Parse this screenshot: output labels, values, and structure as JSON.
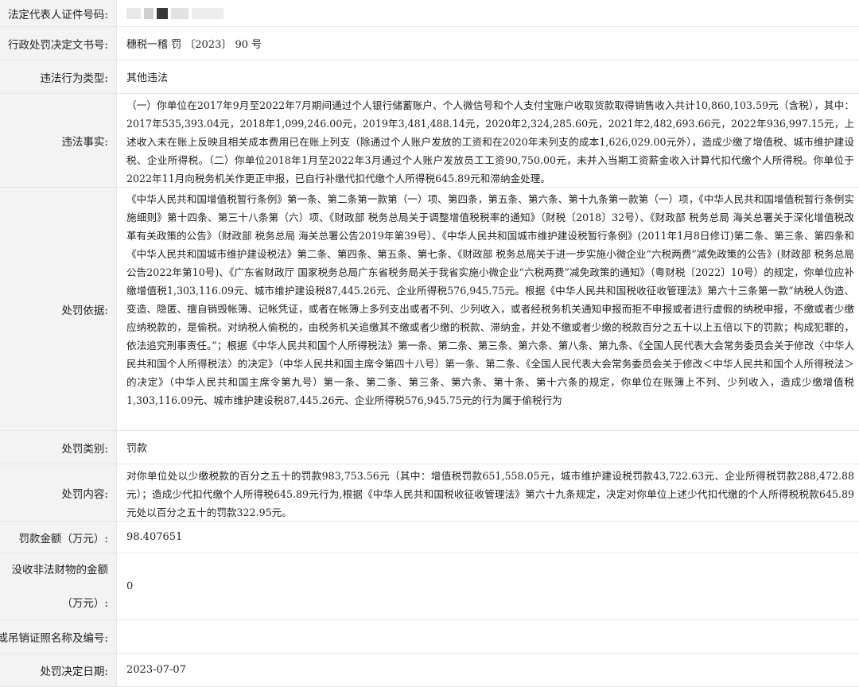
{
  "rows": {
    "id_number": {
      "label": "法定代表人证件号码:",
      "value": ""
    },
    "doc_number": {
      "label": "行政处罚决定文书号:",
      "value": "穗税一稽 罚 〔2023〕 90 号"
    },
    "violation_type": {
      "label": "违法行为类型:",
      "value": "其他违法"
    },
    "facts": {
      "label": "违法事实:",
      "value": "（一）你单位在2017年9月至2022年7月期间通过个人银行储蓄账户、个人微信号和个人支付宝账户收取货款取得销售收入共计10,860,103.59元（含税），其中：2017年535,393.04元，2018年1,099,246.00元，2019年3,481,488.14元，2020年2,324,285.60元，2021年2,482,693.66元，2022年936,997.15元，上述收入未在账上反映且相关成本费用已在账上列支（除通过个人账户发放的工资和在2020年未列支的成本1,626,029.00元外），造成少缴了增值税、城市维护建设税、企业所得税。（二）你单位2018年1月至2022年3月通过个人账户发放员工工资90,750.00元，未并入当期工资薪金收入计算代扣代缴个人所得税。你单位于2022年11月向税务机关作更正申报，已自行补缴代扣代缴个人所得税645.89元和滞纳金处理。"
    },
    "basis": {
      "label": "处罚依据:",
      "value": "《中华人民共和国增值税暂行条例》第一条、第二条第一款第（一）项、第四条，第五条、第六条、第十九条第一款第（一）项，《中华人民共和国增值税暂行条例实施细则》第十四条、第三十八条第（六）项、《财政部 税务总局关于调整增值税税率的通知》（财税〔2018〕32号）、《财政部 税务总局 海关总署关于深化增值税改革有关政策的公告》（财政部 税务总局 海关总署公告2019年第39号）、《中华人民共和国城市维护建设税暂行条例》(2011年1月8日修订)第二条、第三条、第四条和《中华人民共和国城市维护建设税法》第二条、第四条、第五条、第七条、《财政部 税务总局关于进一步实施小微企业“六税两费”减免政策的公告》(财政部 税务总局公告2022年第10号)、《广东省财政厅 国家税务总局广东省税务局关于我省实施小微企业“六税两费”减免政策的通知》（粤财税〔2022〕10号）的规定，你单位应补缴增值税1,303,116.09元、城市维护建设税87,445.26元、企业所得税576,945.75元。根据《中华人民共和国税收征收管理法》第六十三条第一款“纳税人伪造、变造、隐匿、擅自销毁帐簿、记帐凭证，或者在帐簿上多列支出或者不列、少列收入，或者经税务机关通知申报而拒不申报或者进行虚假的纳税申报，不缴或者少缴应纳税款的，是偷税。对纳税人偷税的，由税务机关追缴其不缴或者少缴的税款、滞纳金，并处不缴或者少缴的税款百分之五十以上五倍以下的罚款；构成犯罪的，依法追究刑事责任。”；根据《中华人民共和国个人所得税法》第一条、第二条、第三条、第六条、第八条、第九条、《全国人民代表大会常务委员会关于修改〈中华人民共和国个人所得税法〉的决定》（中华人民共和国主席令第四十八号）第一条、第二条、《全国人民代表大会常务委员会关于修改＜中华人民共和国个人所得税法＞的决定》（中华人民共和国主席令第九号）第一条、第二条、第三条、第六条、第十条、第十六条的规定，你单位在账簿上不列、少列收入，造成少缴增值税1,303,116.09元、城市维护建设税87,445.26元、企业所得税576,945.75元的行为属于偷税行为"
    },
    "category": {
      "label": "处罚类别:",
      "value": "罚款"
    },
    "content": {
      "label": "处罚内容:",
      "value": "对你单位处以少缴税款的百分之五十的罚款983,753.56元（其中：增值税罚款651,558.05元，城市维护建设税罚款43,722.63元、企业所得税罚款288,472.88元）；造成少代扣代缴个人所得税645.89元行为,根据《中华人民共和国税收征收管理法》第六十九条规定，决定对你单位上述少代扣代缴的个人所得税税款645.89元处以百分之五十的罚款322.95元。"
    },
    "amount": {
      "label": "罚款金额（万元）:",
      "value": "98.407651"
    },
    "confiscated": {
      "label_line1": "没收非法财物的金额",
      "label_line2": "（万元）:",
      "value": "0"
    },
    "license": {
      "label": "或吊销证照名称及编号:",
      "value": ""
    },
    "date": {
      "label": "处罚决定日期:",
      "value": "2023-07-07"
    }
  }
}
